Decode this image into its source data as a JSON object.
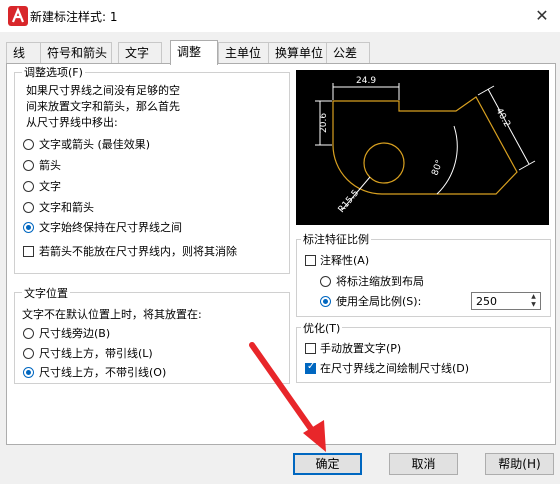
{
  "window": {
    "title": "新建标注样式: 1",
    "close_glyph": "✕"
  },
  "tabs": [
    {
      "label": "线"
    },
    {
      "label": "符号和箭头"
    },
    {
      "label": "文字"
    },
    {
      "label": "调整",
      "active": true
    },
    {
      "label": "主单位"
    },
    {
      "label": "换算单位"
    },
    {
      "label": "公差"
    }
  ],
  "fit_options": {
    "title": "调整选项(F)",
    "description": [
      "如果尺寸界线之间没有足够的空",
      "间来放置文字和箭头，那么首先",
      "从尺寸界线中移出:"
    ],
    "radios": [
      {
        "label": "文字或箭头 (最佳效果)",
        "selected": false
      },
      {
        "label": "箭头",
        "selected": false
      },
      {
        "label": "文字",
        "selected": false
      },
      {
        "label": "文字和箭头",
        "selected": false
      },
      {
        "label": "文字始终保持在尺寸界线之间",
        "selected": true
      }
    ],
    "suppress_checkbox": {
      "label": "若箭头不能放在尺寸界线内，则将其消除",
      "checked": false
    }
  },
  "text_placement": {
    "title": "文字位置",
    "description": "文字不在默认位置上时，将其放置在:",
    "radios": [
      {
        "label": "尺寸线旁边(B)",
        "selected": false
      },
      {
        "label": "尺寸线上方，带引线(L)",
        "selected": false
      },
      {
        "label": "尺寸线上方，不带引线(O)",
        "selected": true
      }
    ]
  },
  "preview": {
    "dims": [
      "24.9",
      "20.6",
      "40.2",
      "80°",
      "R15.5"
    ],
    "colors": {
      "bg": "#000000",
      "geometry": "#d8a020",
      "dims": "#ffffff"
    }
  },
  "scale": {
    "title": "标注特征比例",
    "annotative": {
      "label": "注释性(A)",
      "checked": false
    },
    "layout_radio": {
      "label": "将标注缩放到布局",
      "selected": false
    },
    "global_radio": {
      "label": "使用全局比例(S):",
      "selected": true
    },
    "global_value": "250"
  },
  "fine_tuning": {
    "title": "优化(T)",
    "manual": {
      "label": "手动放置文字(P)",
      "checked": false
    },
    "draw_between": {
      "label": "在尺寸界线之间绘制尺寸线(D)",
      "checked": true
    }
  },
  "buttons": {
    "ok": "确定",
    "cancel": "取消",
    "help": "帮助(H)"
  },
  "accent": "#0067c0",
  "annotation_arrow_color": "#e8262a"
}
